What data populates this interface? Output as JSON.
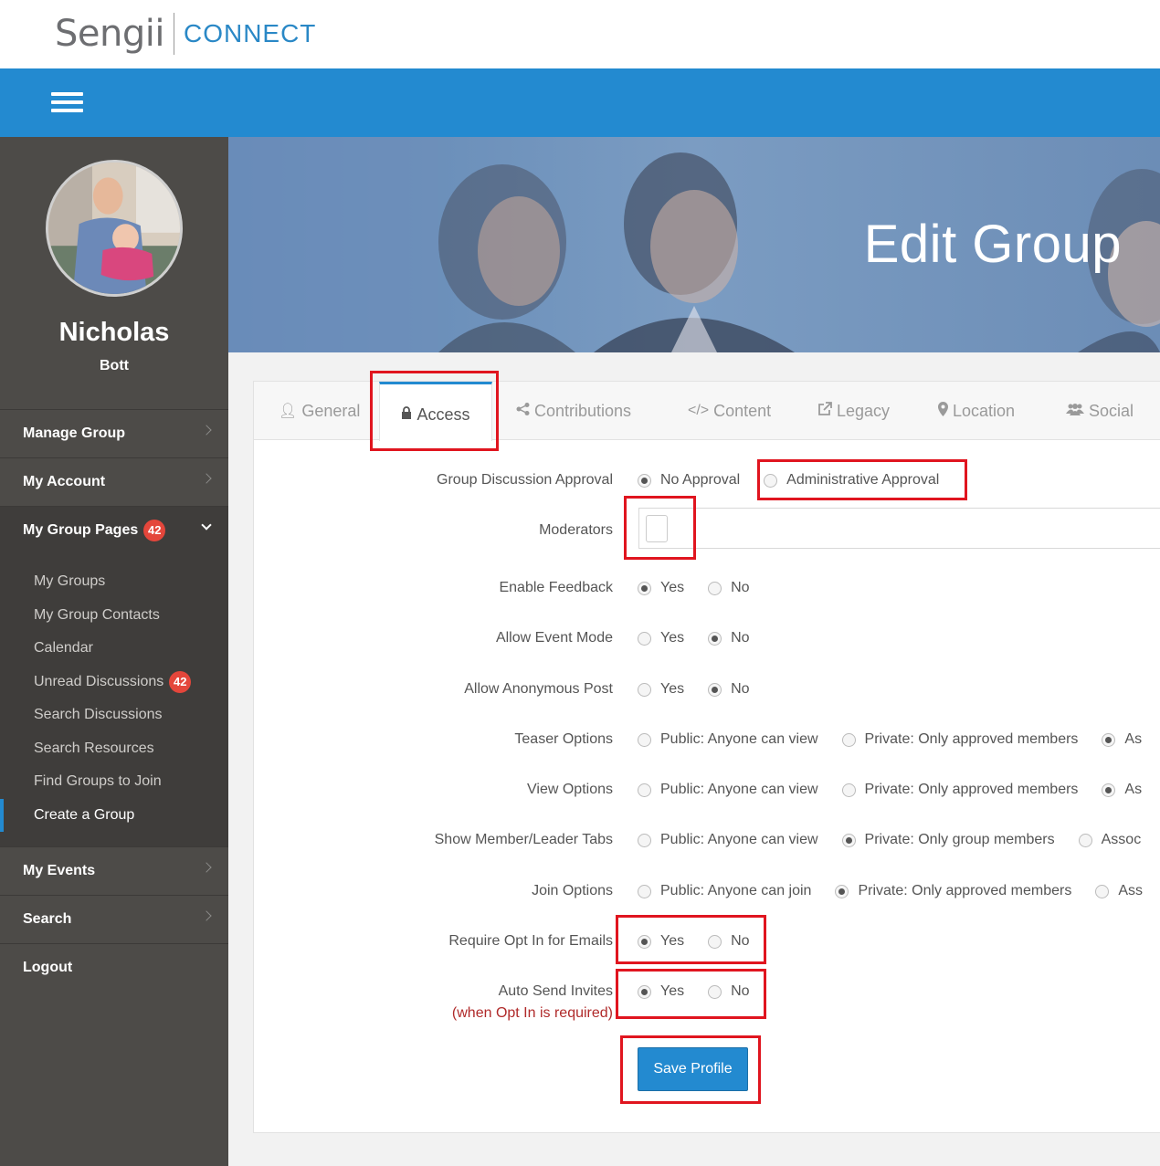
{
  "header": {
    "logo_text": "Sengii",
    "logo_connect": "CONNECT"
  },
  "user": {
    "first_name": "Nicholas",
    "last_name": "Bott"
  },
  "sidebar": {
    "items": [
      {
        "label": "Manage Group"
      },
      {
        "label": "My Account"
      },
      {
        "label": "My Group Pages",
        "badge": "42"
      },
      {
        "label": "My Events"
      },
      {
        "label": "Search"
      },
      {
        "label": "Logout"
      }
    ],
    "sub_items": [
      {
        "label": "My Groups"
      },
      {
        "label": "My Group Contacts"
      },
      {
        "label": "Calendar"
      },
      {
        "label": "Unread Discussions",
        "badge": "42"
      },
      {
        "label": "Search Discussions"
      },
      {
        "label": "Search Resources"
      },
      {
        "label": "Find Groups to Join"
      },
      {
        "label": "Create a Group"
      }
    ]
  },
  "hero": {
    "title": "Edit Group"
  },
  "tabs": [
    {
      "label": "General",
      "icon": "user-icon"
    },
    {
      "label": "Access",
      "icon": "lock-icon"
    },
    {
      "label": "Contributions",
      "icon": "share-icon"
    },
    {
      "label": "Content",
      "icon": "code-icon"
    },
    {
      "label": "Legacy",
      "icon": "external-link-icon"
    },
    {
      "label": "Location",
      "icon": "map-marker-icon"
    },
    {
      "label": "Social",
      "icon": "users-icon"
    }
  ],
  "form": {
    "discussion_approval": {
      "label": "Group Discussion Approval",
      "opt1": "No Approval",
      "opt2": "Administrative Approval"
    },
    "moderators": {
      "label": "Moderators"
    },
    "enable_feedback": {
      "label": "Enable Feedback",
      "yes": "Yes",
      "no": "No"
    },
    "event_mode": {
      "label": "Allow Event Mode",
      "yes": "Yes",
      "no": "No"
    },
    "anonymous_post": {
      "label": "Allow Anonymous Post",
      "yes": "Yes",
      "no": "No"
    },
    "teaser": {
      "label": "Teaser Options",
      "opt1": "Public: Anyone can view",
      "opt2": "Private: Only approved members",
      "opt3": "As"
    },
    "view": {
      "label": "View Options",
      "opt1": "Public: Anyone can view",
      "opt2": "Private: Only approved members",
      "opt3": "As"
    },
    "member_tabs": {
      "label": "Show Member/Leader Tabs",
      "opt1": "Public: Anyone can view",
      "opt2": "Private: Only group members",
      "opt3": "Assoc"
    },
    "join": {
      "label": "Join Options",
      "opt1": "Public: Anyone can join",
      "opt2": "Private: Only approved members",
      "opt3": "Ass"
    },
    "opt_in": {
      "label": "Require Opt In for Emails",
      "yes": "Yes",
      "no": "No"
    },
    "auto_invite": {
      "label": "Auto Send Invites",
      "sublabel": "(when Opt In is required)",
      "yes": "Yes",
      "no": "No"
    },
    "save_label": "Save Profile"
  },
  "colors": {
    "primary": "#238ad0",
    "sidebar": "#4d4b48",
    "badge": "#e4463b",
    "highlight": "#e0151f"
  }
}
